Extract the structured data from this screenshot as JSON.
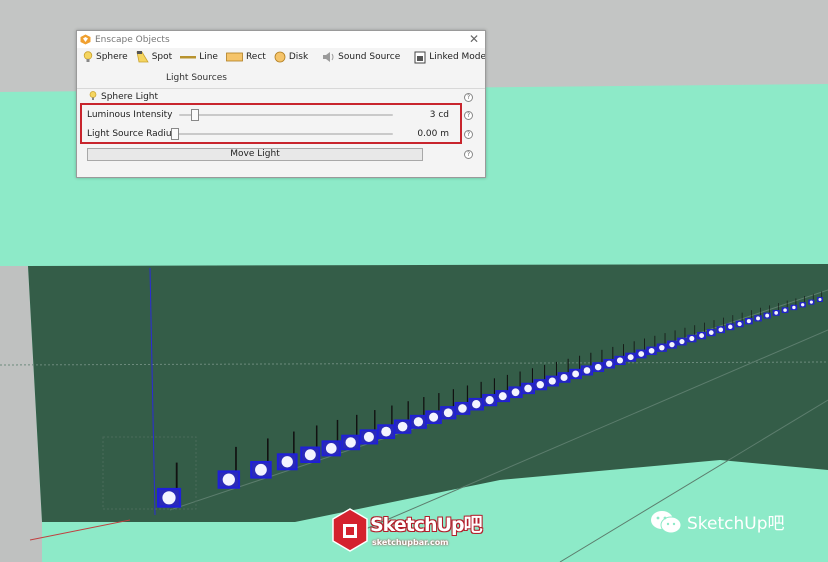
{
  "dialog": {
    "title": "Enscape Objects",
    "close_glyph": "✕",
    "toolbar": {
      "items": [
        {
          "label": "Sphere",
          "icon": "sphere-light-icon"
        },
        {
          "label": "Spot",
          "icon": "spot-light-icon"
        },
        {
          "label": "Line",
          "icon": "line-light-icon"
        },
        {
          "label": "Rect",
          "icon": "rect-light-icon"
        },
        {
          "label": "Disk",
          "icon": "disk-light-icon"
        },
        {
          "label": "Sound Source",
          "icon": "speaker-icon"
        },
        {
          "label": "Linked Model",
          "icon": "linked-model-icon"
        }
      ],
      "group_caption": "Light Sources"
    },
    "selected_type": "Sphere Light",
    "luminous_intensity": {
      "label": "Luminous Intensity",
      "value": "3 cd",
      "slider_fraction": 0.06
    },
    "source_radius": {
      "label": "Light Source Radius",
      "value": "0.00 m",
      "slider_fraction": 0.0
    },
    "move_button": "Move Light",
    "help_glyph": "?"
  },
  "watermark": {
    "brand": "SketchUp吧",
    "url": "sketchupbar.com",
    "wechat_label": "SketchUp吧"
  },
  "colors": {
    "sky_band": "#8deac8",
    "ground": "#345d48",
    "highlight": "#c8252d",
    "light_box": "#1f1fd9"
  }
}
